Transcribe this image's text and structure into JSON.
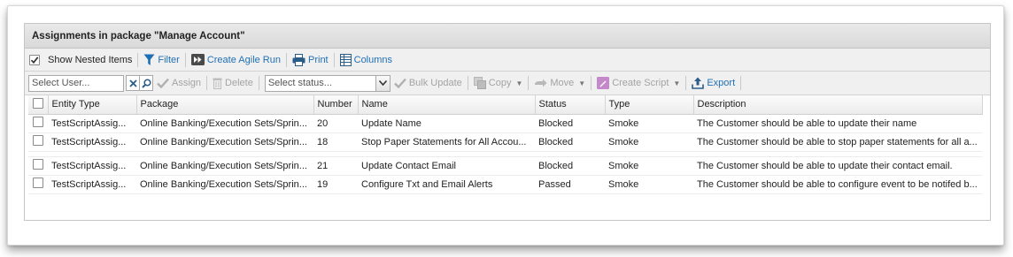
{
  "panel": {
    "title": "Assignments in package \"Manage Account\""
  },
  "toolbar1": {
    "show_nested_label": "Show Nested Items",
    "show_nested_checked": true,
    "filter_label": "Filter",
    "create_agile_run_label": "Create Agile Run",
    "print_label": "Print",
    "columns_label": "Columns"
  },
  "toolbar2": {
    "user_placeholder": "Select User...",
    "assign_label": "Assign",
    "delete_label": "Delete",
    "status_placeholder": "Select status...",
    "bulk_update_label": "Bulk Update",
    "copy_label": "Copy",
    "move_label": "Move",
    "create_script_label": "Create Script",
    "export_label": "Export"
  },
  "table": {
    "columns": [
      "Entity Type",
      "Package",
      "Number",
      "Name",
      "Status",
      "Type",
      "Description"
    ],
    "rows": [
      {
        "entity_type": "TestScriptAssig...",
        "package": "Online Banking/Execution Sets/Sprin...",
        "number": "20",
        "name": "Update Name",
        "status": "Blocked",
        "type": "Smoke",
        "description": "The Customer should be able to update their name"
      },
      {
        "entity_type": "TestScriptAssig...",
        "package": "Online Banking/Execution Sets/Sprin...",
        "number": "18",
        "name": "Stop Paper Statements for All Accou...",
        "status": "Blocked",
        "type": "Smoke",
        "description": "The Customer should be able to stop paper statements for all a..."
      },
      {
        "entity_type": "TestScriptAssig...",
        "package": "Online Banking/Execution Sets/Sprin...",
        "number": "21",
        "name": "Update Contact Email",
        "status": "Blocked",
        "type": "Smoke",
        "description": "The Customer should be able to update their contact email."
      },
      {
        "entity_type": "TestScriptAssig...",
        "package": "Online Banking/Execution Sets/Sprin...",
        "number": "19",
        "name": "Configure Txt and Email Alerts",
        "status": "Passed",
        "type": "Smoke",
        "description": "The Customer should be able to configure event to be notifed b..."
      }
    ]
  },
  "colors": {
    "link": "#1f6fb5",
    "disabled": "#a3a3a3",
    "header_bg": "#dddddd"
  }
}
